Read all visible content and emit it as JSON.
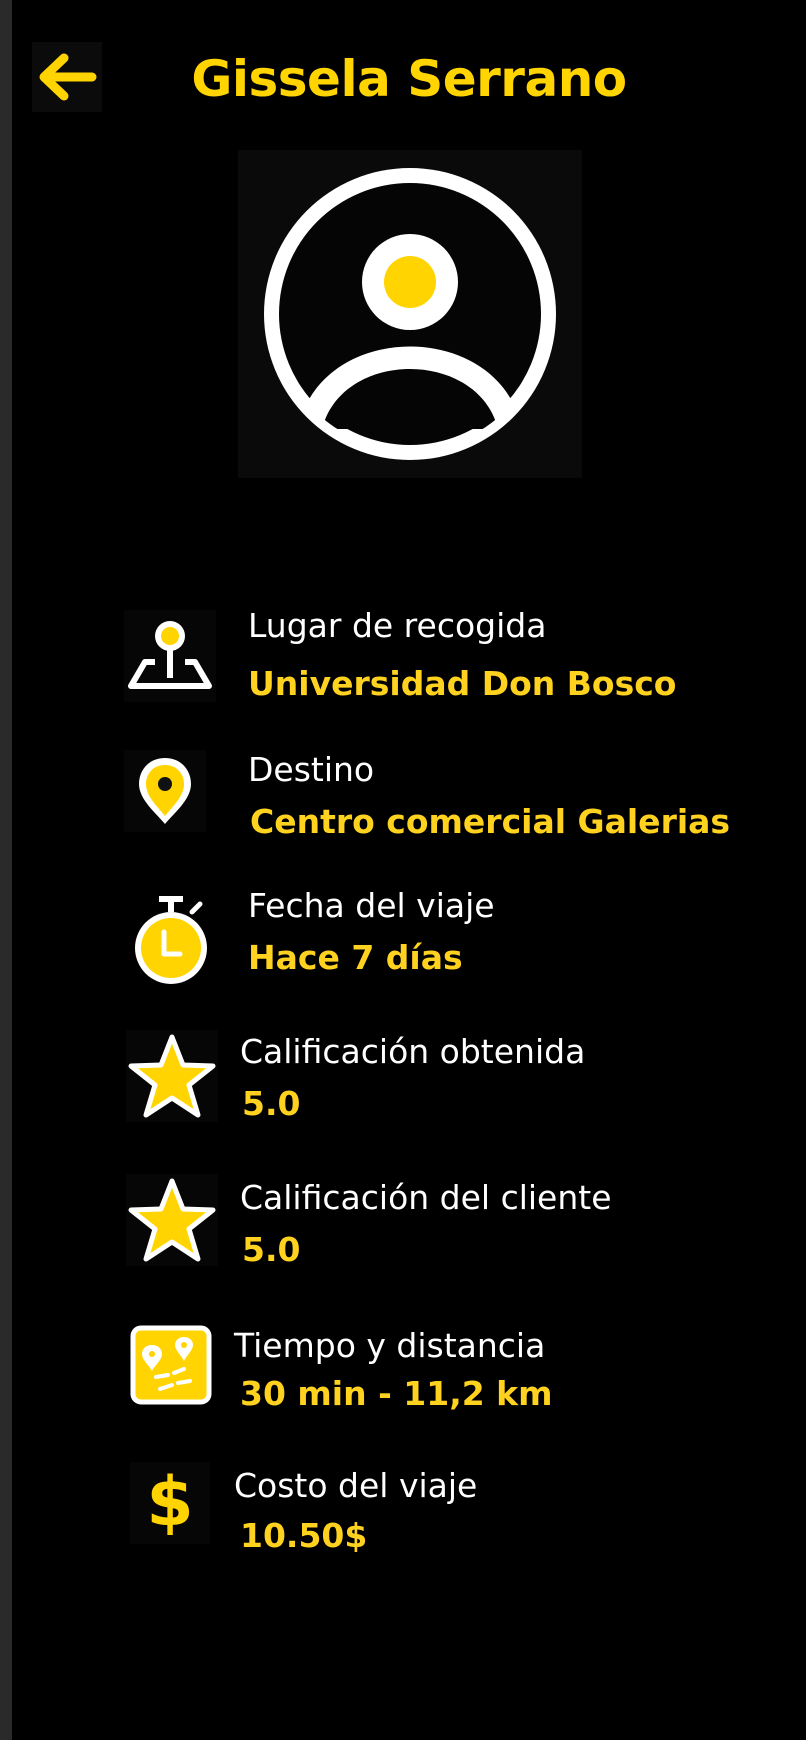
{
  "header": {
    "title": "Gissela Serrano"
  },
  "colors": {
    "accent": "#FFD400",
    "background": "#000000",
    "text": "#ffffff"
  },
  "details": [
    {
      "icon": "pickup-pin-icon",
      "label": "Lugar de recogida",
      "value": "Universidad Don Bosco"
    },
    {
      "icon": "location-marker-icon",
      "label": "Destino",
      "value": "Centro comercial Galerias"
    },
    {
      "icon": "stopwatch-icon",
      "label": "Fecha del viaje",
      "value": "Hace 7 días"
    },
    {
      "icon": "star-icon",
      "label": "Calificación obtenida",
      "value": "5.0"
    },
    {
      "icon": "star-icon",
      "label": "Calificación del cliente",
      "value": "5.0"
    },
    {
      "icon": "map-icon",
      "label": "Tiempo y distancia",
      "value": "30 min - 11,2 km"
    },
    {
      "icon": "dollar-icon",
      "label": "Costo del viaje",
      "value": "10.50$"
    }
  ]
}
